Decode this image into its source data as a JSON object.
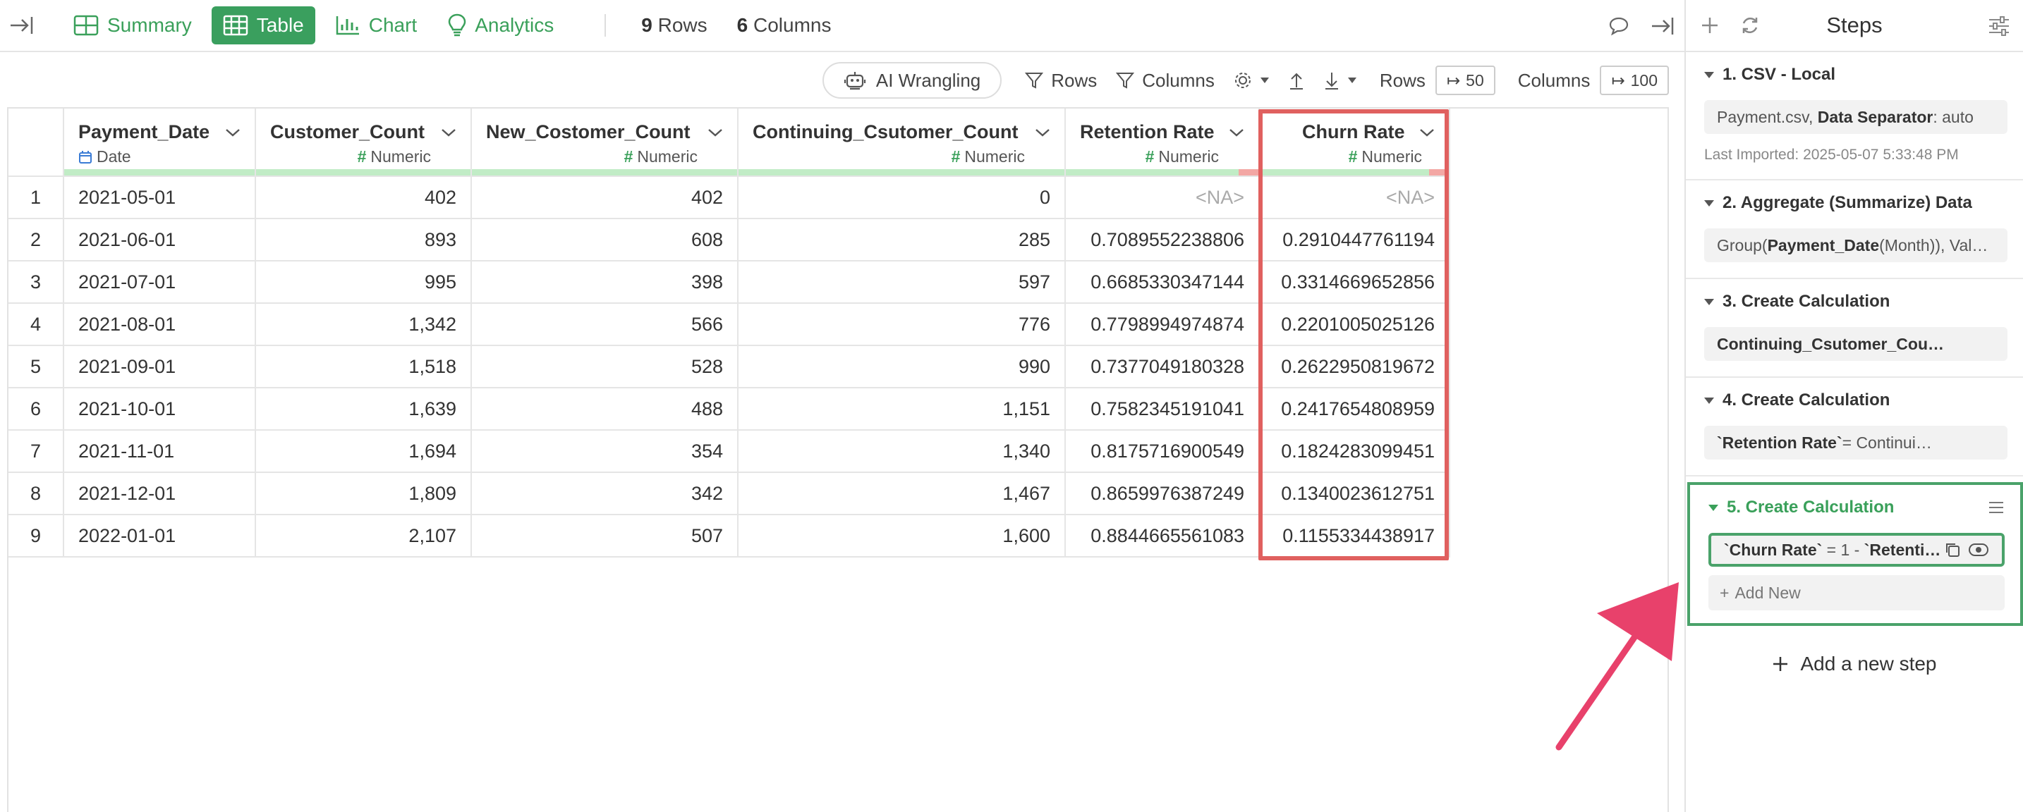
{
  "toolbar": {
    "tabs": [
      {
        "label": "Summary",
        "active": false
      },
      {
        "label": "Table",
        "active": true
      },
      {
        "label": "Chart",
        "active": false
      },
      {
        "label": "Analytics",
        "active": false
      }
    ],
    "row_count": "9",
    "row_label": "Rows",
    "col_count": "6",
    "col_label": "Columns"
  },
  "toolbar2": {
    "ai_wrangling": "AI Wrangling",
    "rows_filter": "Rows",
    "columns_filter": "Columns",
    "rows_label": "Rows",
    "rows_value": "50",
    "columns_label": "Columns",
    "columns_value": "100"
  },
  "table": {
    "columns": [
      {
        "name": "Payment_Date",
        "type": "Date"
      },
      {
        "name": "Customer_Count",
        "type": "Numeric"
      },
      {
        "name": "New_Costomer_Count",
        "type": "Numeric"
      },
      {
        "name": "Continuing_Csutomer_Count",
        "type": "Numeric"
      },
      {
        "name": "Retention Rate",
        "type": "Numeric"
      },
      {
        "name": "Churn Rate",
        "type": "Numeric"
      }
    ],
    "rows": [
      [
        "1",
        "2021-05-01",
        "402",
        "402",
        "0",
        "<NA>",
        "<NA>"
      ],
      [
        "2",
        "2021-06-01",
        "893",
        "608",
        "285",
        "0.7089552238806",
        "0.2910447761194"
      ],
      [
        "3",
        "2021-07-01",
        "995",
        "398",
        "597",
        "0.6685330347144",
        "0.3314669652856"
      ],
      [
        "4",
        "2021-08-01",
        "1,342",
        "566",
        "776",
        "0.7798994974874",
        "0.2201005025126"
      ],
      [
        "5",
        "2021-09-01",
        "1,518",
        "528",
        "990",
        "0.7377049180328",
        "0.2622950819672"
      ],
      [
        "6",
        "2021-10-01",
        "1,639",
        "488",
        "1,151",
        "0.7582345191041",
        "0.2417654808959"
      ],
      [
        "7",
        "2021-11-01",
        "1,694",
        "354",
        "1,340",
        "0.8175716900549",
        "0.1824283099451"
      ],
      [
        "8",
        "2021-12-01",
        "1,809",
        "342",
        "1,467",
        "0.8659976387249",
        "0.1340023612751"
      ],
      [
        "9",
        "2022-01-01",
        "2,107",
        "507",
        "1,600",
        "0.8844665561083",
        "0.1155334438917"
      ]
    ]
  },
  "panel": {
    "title": "Steps",
    "steps": [
      {
        "title": "1. CSV - Local",
        "file": "Payment.csv,",
        "sep_label": "Data Separator",
        "sep_value": ": auto",
        "meta": "Last Imported: 2025-05-07 5:33:48 PM"
      },
      {
        "title": "2. Aggregate (Summarize) Data",
        "pre": "Group(",
        "bold": "Payment_Date",
        "post": " (Month)), Val…"
      },
      {
        "title": "3. Create Calculation",
        "box": "Continuing_Csutomer_Cou…"
      },
      {
        "title": "4. Create Calculation",
        "box_bold": "`Retention Rate`",
        "box_post": " = Continui…"
      },
      {
        "title": "5. Create Calculation",
        "box_bold": "`Churn Rate`",
        "box_mid": " = 1 - ",
        "box_bold2": "`Retenti…",
        "add_new": "Add New"
      }
    ],
    "add_step": "Add a new step"
  },
  "colors": {
    "accent": "#3a9f5e",
    "highlight": "#e0605f",
    "arrow": "#e8416b"
  }
}
